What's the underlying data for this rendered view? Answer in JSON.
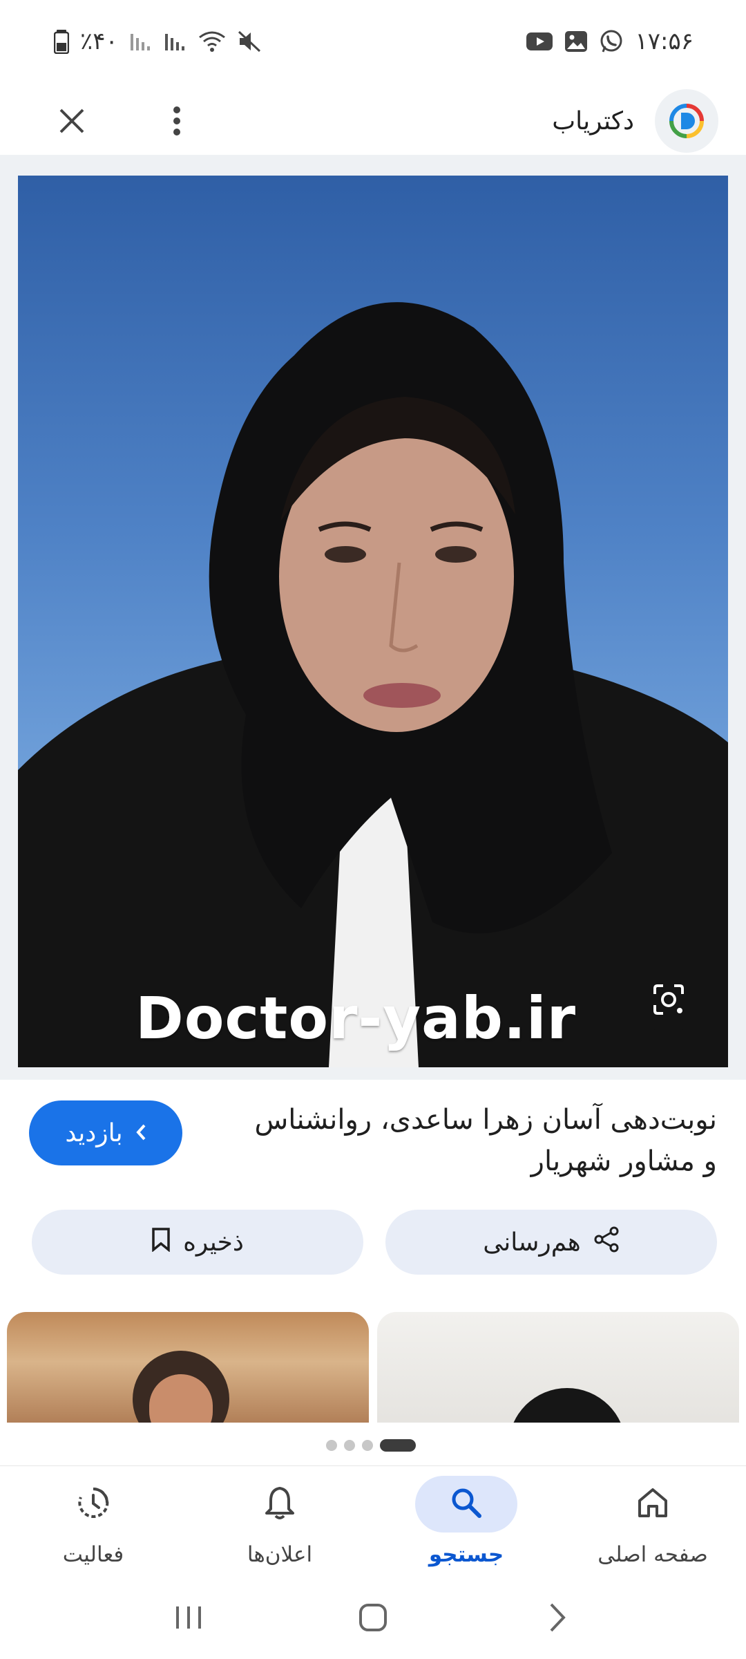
{
  "status_bar": {
    "time": "۱۷:۵۶",
    "battery_text": "٪۴۰",
    "icons_left": [
      "battery-icon",
      "signal-icon",
      "signal-icon",
      "wifi-icon",
      "mute-icon"
    ],
    "icons_right": [
      "youtube-icon",
      "gallery-icon",
      "whatsapp-icon"
    ]
  },
  "header": {
    "site_name": "دکتریاب",
    "logo_icon": "doctoryab-logo-icon",
    "menu_icon": "more-vert-icon",
    "close_icon": "close-icon"
  },
  "viewer": {
    "watermark": "Doctor-yab.ir",
    "lens_icon": "google-lens-icon",
    "photo_colors": {
      "background_top": "#2f5fa6",
      "background_bottom": "#8fb8e5"
    }
  },
  "result": {
    "title": "نوبت‌دهی آسان زهرا ساعدی، روانشناس و مشاور شهریار",
    "visit_label": "بازدید",
    "share_label": "هم‌رسانی",
    "save_label": "ذخیره"
  },
  "pager": {
    "count": 4,
    "active_index": 3
  },
  "bottom_nav": {
    "items": [
      {
        "label": "صفحه اصلی",
        "icon": "home-icon",
        "active": false
      },
      {
        "label": "جستجو",
        "icon": "search-icon",
        "active": true
      },
      {
        "label": "اعلان‌ها",
        "icon": "bell-icon",
        "active": false
      },
      {
        "label": "فعالیت",
        "icon": "activity-icon",
        "active": false
      }
    ]
  },
  "colors": {
    "accent": "#1a73e8",
    "active_nav_pill": "#dde6fb",
    "active_nav_text": "#0b57d0",
    "action_button_bg": "#e8edf7"
  }
}
